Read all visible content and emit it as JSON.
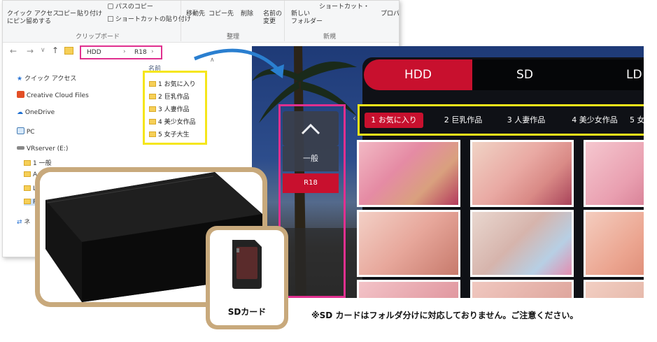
{
  "explorer": {
    "ribbon": {
      "quick_access_label": "クイック アクセス",
      "quick_access_label2": "にピン留めする",
      "copy": "コピー",
      "paste": "貼り付け",
      "copy_path": "パスのコピー",
      "paste_shortcut": "ショートカットの貼り付け",
      "clipboard_group": "クリップボード",
      "move_to": "移動先",
      "copy_to": "コピー先",
      "delete": "削除",
      "rename1": "名前の",
      "rename2": "変更",
      "new_folder1": "新しい",
      "new_folder2": "フォルダー",
      "shortcut": "ショートカット・",
      "properties": "プロパ",
      "organize_group": "整理",
      "new_group": "新規"
    },
    "address": {
      "part1": "HDD",
      "sep1": "›",
      "part2": "R18",
      "sep2": "›"
    },
    "nav_pane": {
      "quick_access": "クイック アクセス",
      "creative_cloud": "Creative Cloud Files",
      "onedrive": "OneDrive",
      "pc": "PC",
      "vrserver": "VRserver (E:)",
      "folder1": "1 一般",
      "folder2": "A",
      "folder3": "L",
      "folder4": "R",
      "network": "ネ"
    },
    "list": {
      "header": "名前",
      "items": [
        "1 お気に入り",
        "2 巨乳作品",
        "3 人妻作品",
        "4 美少女作品",
        "5 女子大生"
      ]
    }
  },
  "vr": {
    "tabs": [
      "HDD",
      "SD",
      "LD"
    ],
    "nav": {
      "general": "一般",
      "r18": "R18"
    },
    "categories": [
      "1 お気に入り",
      "2 巨乳作品",
      "3 人妻作品",
      "4 美少女作品",
      "5 女"
    ]
  },
  "sd_card": {
    "label": "SDカード"
  },
  "note": "※SD カードはフォルダ分けに対応しておりません。ご注意ください。",
  "colors": {
    "accent_red": "#c8102e",
    "highlight_magenta": "#e0308f",
    "highlight_yellow": "#f5e61a",
    "card_border": "#c8a97c"
  }
}
